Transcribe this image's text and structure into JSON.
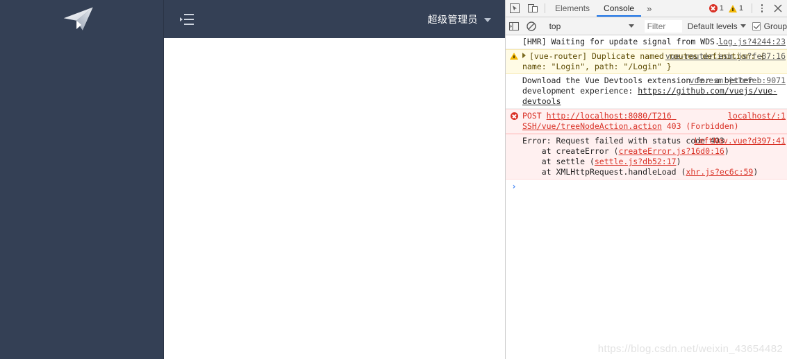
{
  "app": {
    "logo_icon": "paper-plane-icon",
    "sidebar_bg": "#344055",
    "topbar": {
      "fold_icon": "menu-fold-icon",
      "user_name": "超级管理员",
      "caret_icon": "chevron-down-icon"
    }
  },
  "devtools": {
    "toolbar": {
      "inspect_icon": "inspect-element-icon",
      "device_icon": "device-toolbar-icon",
      "tabs": [
        {
          "label": "Elements",
          "active": false
        },
        {
          "label": "Console",
          "active": true
        }
      ],
      "more_tabs_label": "»",
      "error_count": "1",
      "warning_count": "1",
      "error_icon": "error-circle-icon",
      "warning_icon": "warning-triangle-icon",
      "menu_icon": "kebab-menu-icon",
      "close_icon": "close-icon"
    },
    "filterbar": {
      "sidebar_icon": "console-sidebar-icon",
      "clear_icon": "clear-console-icon",
      "context": "top",
      "filter_placeholder": "Filter",
      "filter_value": "",
      "levels_label": "Default levels",
      "group_label": "Group",
      "group_checked": true
    },
    "messages": [
      {
        "level": "info",
        "icon": "",
        "text": "[HMR] Waiting for update signal from WDS...",
        "source": "log.js?4244:23"
      },
      {
        "level": "warn",
        "icon": "warning-triangle-icon",
        "expandable": true,
        "text": "[vue-router] Duplicate named routes definition: { name: \"Login\", path: \"/Login\" }",
        "source": "vue-router.esm.js?fe87:16"
      },
      {
        "level": "info",
        "icon": "",
        "text_pre": "Download the Vue Devtools extension for a better development experience:",
        "link": "https://github.com/vuejs/vue-devtools",
        "source": "vue.esm.js?efeb:9071"
      },
      {
        "level": "error",
        "icon": "error-circle-icon",
        "method": "POST",
        "url": "http://localhost:8080/T216 SSH/vue/treeNodeAction.action",
        "status": "403 (Forbidden)",
        "source": "localhost/:1"
      },
      {
        "level": "error",
        "icon": "",
        "text": "Error: Request failed with status code 403",
        "source": "LeftNav.vue?d397:41",
        "stack": [
          {
            "prefix": "    at createError (",
            "link": "createError.js?16d0:16",
            "suffix": ")"
          },
          {
            "prefix": "    at settle (",
            "link": "settle.js?db52:17",
            "suffix": ")"
          },
          {
            "prefix": "    at XMLHttpRequest.handleLoad (",
            "link": "xhr.js?ec6c:59",
            "suffix": ")"
          }
        ]
      }
    ],
    "prompt": {
      "caret": "›",
      "value": ""
    }
  },
  "watermark": "https://blog.csdn.net/weixin_43654482"
}
